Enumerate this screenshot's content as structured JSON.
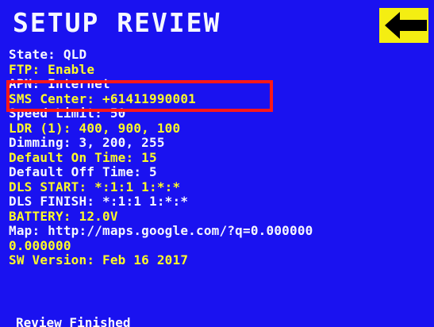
{
  "header": {
    "title": "SETUP REVIEW",
    "back_icon": "left-arrow-icon"
  },
  "review_lines": [
    {
      "text": "State: QLD",
      "color": "#f6f7ff"
    },
    {
      "text": "FTP: Enable",
      "color": "#fffb28"
    },
    {
      "text": "APN: Internet",
      "color": "#f6f7ff"
    },
    {
      "text": "SMS Center: +61411990001",
      "color": "#fffb28"
    },
    {
      "text": "Speed Limit: 50",
      "color": "#f6f7ff"
    },
    {
      "text": "LDR (1): 400, 900, 100",
      "color": "#fffb28"
    },
    {
      "text": "Dimming: 3, 200, 255",
      "color": "#f6f7ff"
    },
    {
      "text": "Default On Time: 15",
      "color": "#fffb28"
    },
    {
      "text": "Default Off Time: 5",
      "color": "#f6f7ff"
    },
    {
      "text": "DLS START: *:1:1 1:*:*",
      "color": "#fffb28"
    },
    {
      "text": "DLS FINISH: *:1:1 1:*:*",
      "color": "#f6f7ff"
    },
    {
      "text": "BATTERY: 12.0V",
      "color": "#fffb28"
    },
    {
      "text": "Map: http://maps.google.com/?q=0.000000",
      "color": "#f6f7ff"
    },
    {
      "text": "0.000000",
      "color": "#fffb28"
    },
    {
      "text": "SW Version: Feb 16 2017",
      "color": "#fffb28"
    }
  ],
  "highlight": {
    "color": "#ff1818"
  },
  "status": {
    "text": "Review Finished"
  },
  "colors": {
    "screen_background": "#1a12f0",
    "button_background": "#f4ee12",
    "arrow": "#000000"
  }
}
